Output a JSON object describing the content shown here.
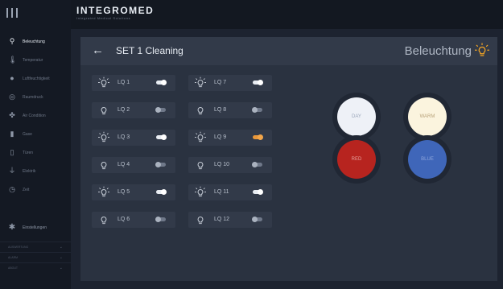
{
  "app": {
    "logo_text": "INTEGROMED",
    "logo_sub": "Integrated Medical Solutions"
  },
  "sidebar": {
    "items": [
      {
        "label": "Beleuchtung",
        "icon": "bulb-icon",
        "active": true
      },
      {
        "label": "Temperatur",
        "icon": "thermometer-icon",
        "active": false
      },
      {
        "label": "Luftfeuchtigkeit",
        "icon": "droplet-icon",
        "active": false
      },
      {
        "label": "Raumdruck",
        "icon": "gauge-icon",
        "active": false
      },
      {
        "label": "Air Condition",
        "icon": "fan-icon",
        "active": false
      },
      {
        "label": "Gase",
        "icon": "gas-cylinder-icon",
        "active": false
      },
      {
        "label": "Türen",
        "icon": "door-icon",
        "active": false
      },
      {
        "label": "Elektrik",
        "icon": "plug-icon",
        "active": false
      },
      {
        "label": "Zeit",
        "icon": "clock-icon",
        "active": false
      }
    ],
    "settings_label": "Einstellungen",
    "footer": [
      "AUSWERTUNG",
      "ALARM",
      "ABOUT"
    ]
  },
  "header": {
    "back_icon": "arrow-left-icon",
    "title": "SET 1 Cleaning",
    "section": "Beleuchtung",
    "section_icon": "bulb-glow-icon"
  },
  "lights": [
    {
      "label": "LQ 1",
      "on": true,
      "state": "on"
    },
    {
      "label": "LQ 2",
      "on": false,
      "state": "off"
    },
    {
      "label": "LQ 3",
      "on": true,
      "state": "on"
    },
    {
      "label": "LQ 4",
      "on": false,
      "state": "off"
    },
    {
      "label": "LQ 5",
      "on": true,
      "state": "on"
    },
    {
      "label": "LQ 6",
      "on": false,
      "state": "off"
    },
    {
      "label": "LQ 7",
      "on": true,
      "state": "on"
    },
    {
      "label": "LQ 8",
      "on": false,
      "state": "off"
    },
    {
      "label": "LQ 9",
      "on": true,
      "state": "orange"
    },
    {
      "label": "LQ 10",
      "on": false,
      "state": "off"
    },
    {
      "label": "LQ 11",
      "on": true,
      "state": "on"
    },
    {
      "label": "LQ 12",
      "on": false,
      "state": "off"
    }
  ],
  "modes": [
    {
      "label": "DAY",
      "bg": "#eef1f7",
      "fg": "#9aa6ba",
      "ring": "#202734"
    },
    {
      "label": "WARM",
      "bg": "#fbf4de",
      "fg": "#b8a27a",
      "ring": "#202734"
    },
    {
      "label": "RED",
      "bg": "#b7241f",
      "fg": "#e6a09c",
      "ring": "#202734"
    },
    {
      "label": "BLUE",
      "bg": "#3f66b9",
      "fg": "#8ea6dc",
      "ring": "#202734"
    }
  ],
  "colors": {
    "accent": "#f5a623",
    "panel": "#2a3240",
    "toggle_on": "#e9edf3"
  }
}
